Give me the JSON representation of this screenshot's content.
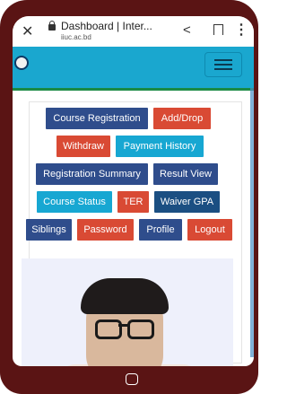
{
  "browser": {
    "page_title": "Dashboard | Inter...",
    "url": "iiuc.ac.bd"
  },
  "icons": [
    "close-icon",
    "lock-icon",
    "share-icon",
    "bookmark-icon",
    "more-vert-icon",
    "menu-icon",
    "home-icon"
  ],
  "buttons": [
    {
      "label": "Course Registration",
      "color": "#2f4d8c"
    },
    {
      "label": "Add/Drop",
      "color": "#d94a34"
    },
    {
      "label": "Withdraw",
      "color": "#d94a34"
    },
    {
      "label": "Payment History",
      "color": "#17a7d2"
    },
    {
      "label": "Registration Summary",
      "color": "#2f4d8c"
    },
    {
      "label": "Result View",
      "color": "#2f4d8c"
    },
    {
      "label": "Course Status",
      "color": "#17a7d2"
    },
    {
      "label": "TER",
      "color": "#d94a34"
    },
    {
      "label": "Waiver GPA",
      "color": "#1b4f82"
    },
    {
      "label": "Siblings",
      "color": "#2f4d8c"
    },
    {
      "label": "Password",
      "color": "#d94a34"
    },
    {
      "label": "Profile",
      "color": "#2f4d8c"
    },
    {
      "label": "Logout",
      "color": "#d94a34"
    }
  ],
  "colors": {
    "navbar": "#1aa7cf",
    "phone_frame": "#5a1414"
  }
}
